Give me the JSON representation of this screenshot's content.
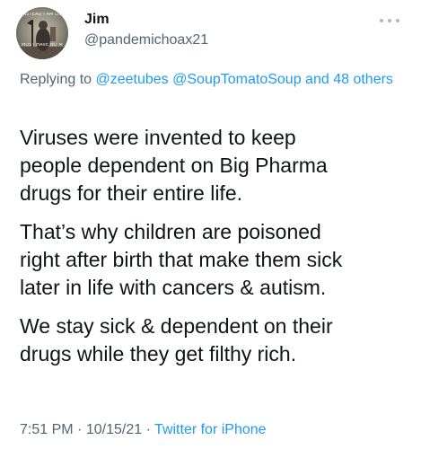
{
  "author": {
    "display_name": "Jim",
    "handle": "@pandemichoax21",
    "avatar_caption_top": "INSTEAD I AM LIGHT PILLAR",
    "avatar_caption_bottom": "MUST HAVE NO MERCY ON THE ELITE"
  },
  "reply": {
    "prefix": "Replying to",
    "mention_1": "@zeetubes",
    "mention_2": "@SoupTomatoSoup",
    "joiner": "and",
    "others": "48 others"
  },
  "tweet": {
    "paragraphs": [
      "Viruses were invented to keep\npeople dependent on Big Pharma\ndrugs for their entire life.",
      "That’s why children are poisoned\nright after birth that make them sick\nlater in life with cancers & autism.",
      "We stay sick & dependent on their\ndrugs while they get filthy rich."
    ]
  },
  "meta": {
    "time": "7:51 PM",
    "separator": "·",
    "date": "10/15/21",
    "source": "Twitter for iPhone"
  },
  "icons": {
    "more": "more-dots-icon"
  },
  "colors": {
    "link": "#1d9bf0",
    "secondary_text": "#536471",
    "primary_text": "#0f1419"
  }
}
